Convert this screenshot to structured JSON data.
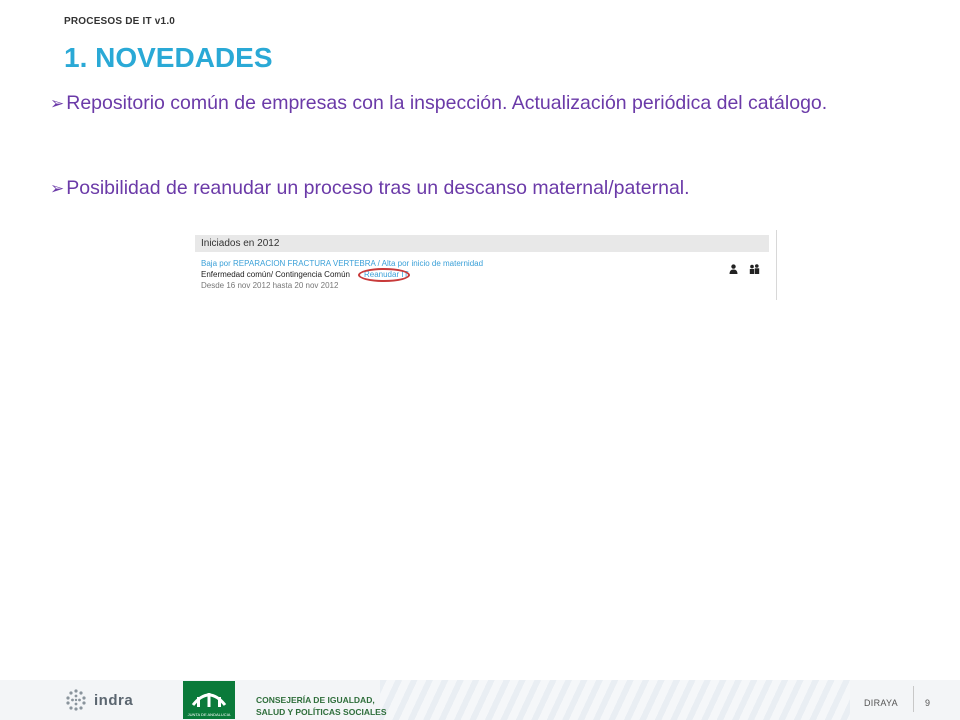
{
  "header": {
    "doc_label": "PROCESOS DE IT v1.0"
  },
  "title": "1. NOVEDADES",
  "bullets": [
    {
      "arrow": "➢",
      "text": "Repositorio común de empresas con la inspección. Actualización periódica del catálogo."
    },
    {
      "arrow": "➢",
      "text": "Posibilidad de reanudar un proceso tras un descanso maternal/paternal."
    }
  ],
  "screenshot": {
    "section_title": "Iniciados en 2012",
    "process_link": "Baja por REPARACION FRACTURA VERTEBRA / Alta por inicio de maternidad",
    "contingency": "Enfermedad común/ Contingencia Común",
    "resume_link": "Reanudar IT",
    "date_range": "Desde 16 nov 2012 hasta 20 nov 2012",
    "icons": [
      "person-icon",
      "group-icon"
    ]
  },
  "footer": {
    "indra": "indra",
    "junta": "JUNTA DE ANDALUCIA",
    "consejeria_line1": "CONSEJERÍA DE IGUALDAD,",
    "consejeria_line2": "SALUD Y POLÍTICAS SOCIALES",
    "app_name": "DIRAYA",
    "page_number": "9"
  },
  "colors": {
    "title": "#2aa9d6",
    "bullet_text": "#6b3aa8",
    "link": "#3aa0d8",
    "highlight": "#c83a3a"
  }
}
